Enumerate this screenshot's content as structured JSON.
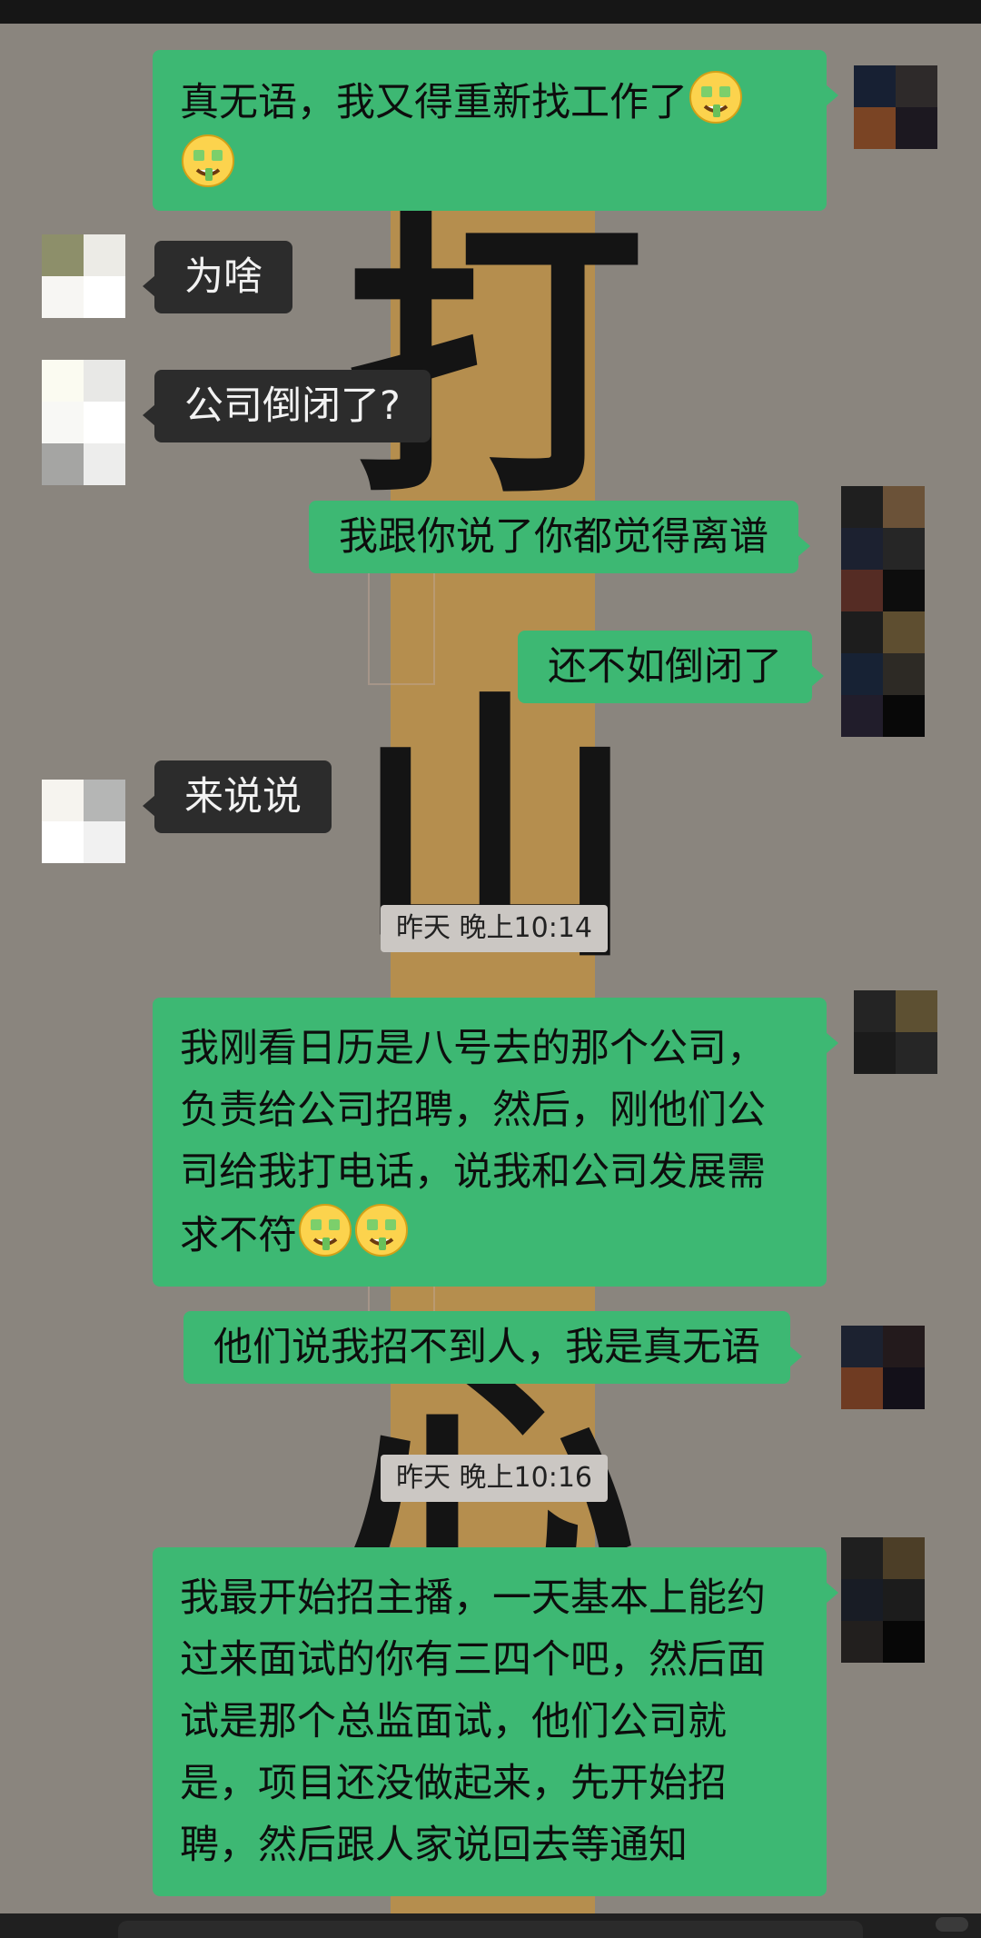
{
  "messages": [
    {
      "text": "真无语，我又得重新找工作了",
      "emojis": "🤑🤑"
    },
    {
      "text": "为啥"
    },
    {
      "text": "公司倒闭了?"
    },
    {
      "text": "我跟你说了你都觉得离谱"
    },
    {
      "text": "还不如倒闭了"
    },
    {
      "text": "来说说"
    },
    {
      "text": "我刚看日历是八号去的那个公司，负责给公司招聘，然后，刚他们公司给我打电话，说我和公司发展需求不符",
      "emojis": "🤑🤑"
    },
    {
      "text": "他们说我招不到人，我是真无语"
    },
    {
      "text": "我最开始招主播，一天基本上能约过来面试的你有三四个吧，然后面试是那个总监面试，他们公司就是，项目还没做起来，先开始招聘，然后跟人家说回去等通知"
    }
  ],
  "timestamps": [
    "昨天 晚上10:14",
    "昨天 晚上10:16"
  ],
  "background_calligraphy": [
    "打",
    "山",
    "一",
    "心"
  ],
  "colors": {
    "outgoing_bubble": "#3db873",
    "incoming_bubble": "#2c2c2c",
    "timestamp_bg": "#cbc7c3",
    "background": "#8a857e"
  }
}
